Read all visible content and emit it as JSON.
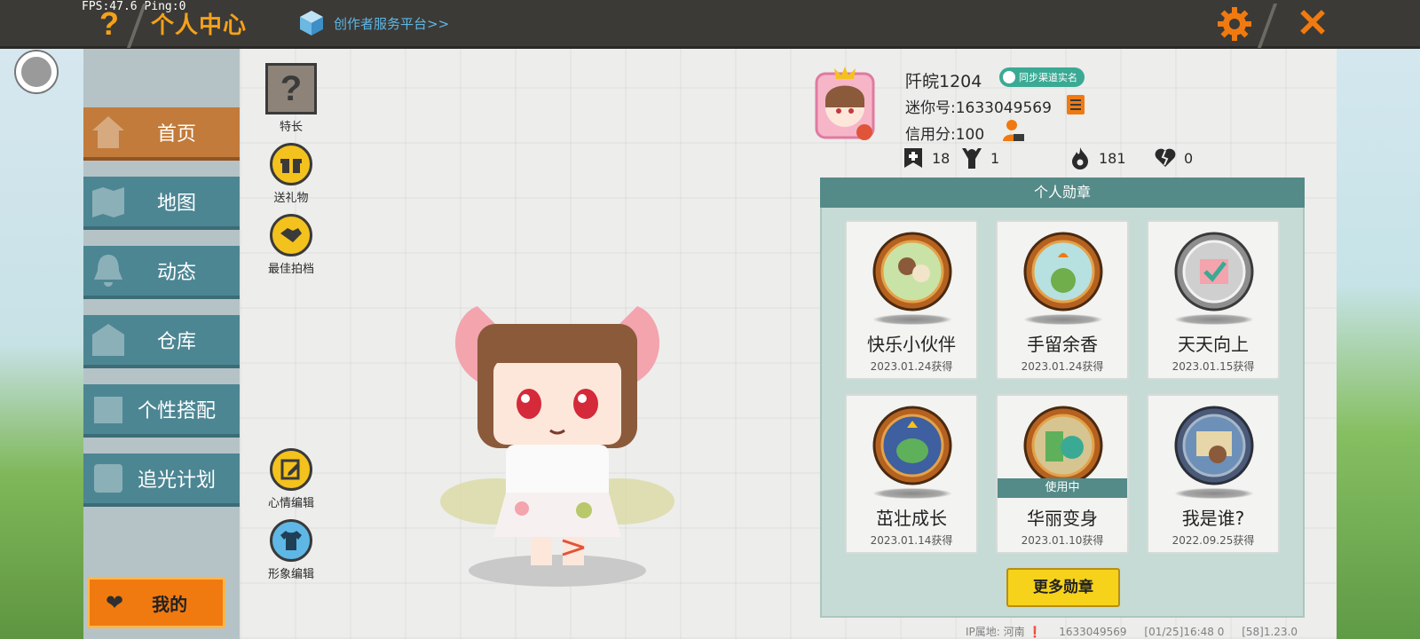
{
  "debug": {
    "fps_ping": "FPS:47.6  Ping:0"
  },
  "header": {
    "help_label": "?",
    "title": "个人中心",
    "creator_link": "创作者服务平台>>",
    "close_label": "✕"
  },
  "sidebar": {
    "items": [
      {
        "label": "首页"
      },
      {
        "label": "地图"
      },
      {
        "label": "动态"
      },
      {
        "label": "仓库"
      },
      {
        "label": "个性搭配"
      },
      {
        "label": "追光计划"
      }
    ],
    "mine_label": "我的"
  },
  "tools": {
    "skill_label": "特长",
    "skill_mark": "?",
    "gift_label": "送礼物",
    "partner_label": "最佳拍档",
    "mood_label": "心情编辑",
    "image_label": "形象编辑"
  },
  "profile": {
    "name": "阡皖1204",
    "sync_badge": "同步渠道实名",
    "mini_no": "迷你号:1633049569",
    "credit": "信用分:100",
    "stats": {
      "add": "18",
      "fans": "1",
      "hot": "181",
      "like": "0"
    }
  },
  "medals": {
    "header": "个人勋章",
    "items": [
      {
        "name": "快乐小伙伴",
        "date": "2023.01.24获得"
      },
      {
        "name": "手留余香",
        "date": "2023.01.24获得"
      },
      {
        "name": "天天向上",
        "date": "2023.01.15获得"
      },
      {
        "name": "茁壮成长",
        "date": "2023.01.14获得"
      },
      {
        "name": "华丽变身",
        "date": "2023.01.10获得",
        "badge": "使用中"
      },
      {
        "name": "我是谁?",
        "date": "2022.09.25获得"
      }
    ],
    "more_button": "更多勋章"
  },
  "footer": {
    "ip": "IP属地: 河南 ❗",
    "id": "1633049569",
    "time": "[01/25]16:48 0",
    "version": "[58]1.23.0"
  },
  "colors": {
    "accent_orange": "#f07a10",
    "sidebar_teal": "#4d8693",
    "sidebar_active": "#c27b3a",
    "panel_header": "#548a87",
    "button_yellow": "#f7d21a"
  }
}
